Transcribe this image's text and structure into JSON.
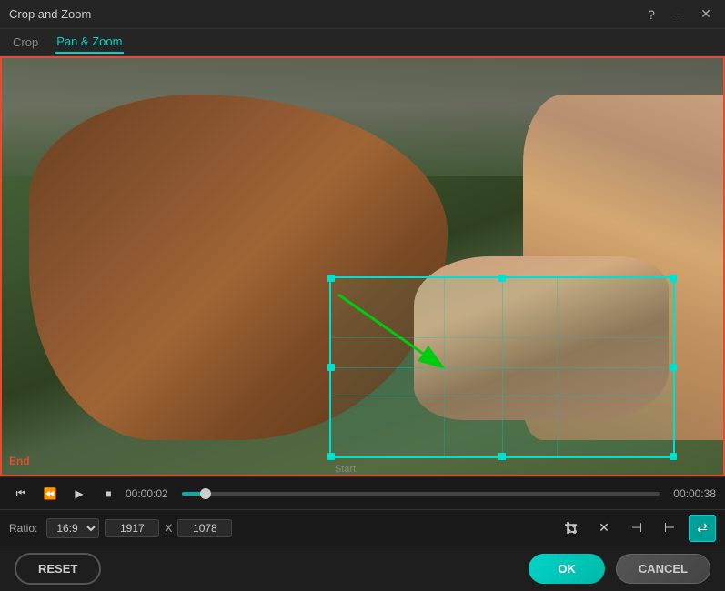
{
  "window": {
    "title": "Crop and Zoom"
  },
  "tabs": [
    {
      "label": "Crop",
      "active": false
    },
    {
      "label": "Pan & Zoom",
      "active": true
    }
  ],
  "video": {
    "end_label": "End",
    "start_label": "Start"
  },
  "controls": {
    "current_time": "00:00:02",
    "total_time": "00:00:38",
    "progress_pct": 5
  },
  "toolbar": {
    "ratio_label": "Ratio:",
    "ratio_value": "16:9",
    "width_value": "1917",
    "x_sep": "X",
    "height_value": "1078"
  },
  "actions": {
    "reset_label": "RESET",
    "ok_label": "OK",
    "cancel_label": "CANCEL"
  }
}
